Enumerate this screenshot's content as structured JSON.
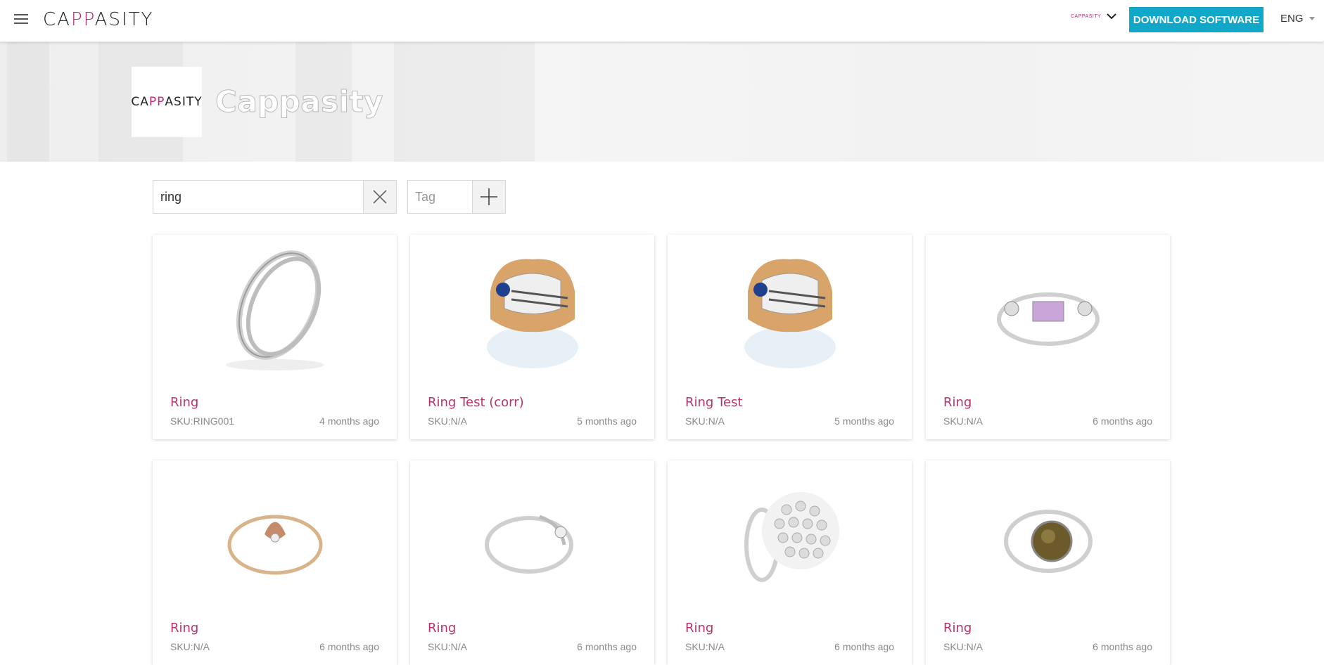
{
  "header": {
    "logo_text": "CAPPASITY",
    "account_logo_text": "CAPPASITY",
    "download_label": "DOWNLOAD SOFTWARE",
    "language": "ENG",
    "accent_color": "#11a7c9",
    "brand_color": "#c0286f"
  },
  "banner": {
    "company_logo_text": "CAPPASITY",
    "company_name": "Cappasity"
  },
  "search": {
    "value": "ring",
    "tag_placeholder": "Tag"
  },
  "models": [
    {
      "title": "Ring",
      "sku": "SKU:RING001",
      "time": "4 months ago"
    },
    {
      "title": "Ring Test (corr)",
      "sku": "SKU:N/A",
      "time": "5 months ago"
    },
    {
      "title": "Ring Test",
      "sku": "SKU:N/A",
      "time": "5 months ago"
    },
    {
      "title": "Ring",
      "sku": "SKU:N/A",
      "time": "6 months ago"
    },
    {
      "title": "Ring",
      "sku": "SKU:N/A",
      "time": "6 months ago"
    },
    {
      "title": "Ring",
      "sku": "SKU:N/A",
      "time": "6 months ago"
    },
    {
      "title": "Ring",
      "sku": "SKU:N/A",
      "time": "6 months ago"
    },
    {
      "title": "Ring",
      "sku": "SKU:N/A",
      "time": "6 months ago"
    }
  ]
}
